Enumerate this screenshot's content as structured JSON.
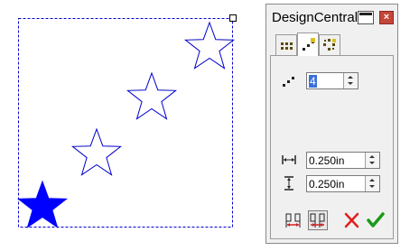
{
  "canvas": {
    "selection": "dashed-bounding-box",
    "stars": [
      {
        "name": "star-solid",
        "fill": "#0000ff"
      },
      {
        "name": "star-outline-2",
        "fill": "none"
      },
      {
        "name": "star-outline-3",
        "fill": "none"
      },
      {
        "name": "star-outline-4",
        "fill": "none"
      }
    ],
    "accent_color": "#0000cc"
  },
  "panel": {
    "title": "DesignCentral",
    "tabs": [
      {
        "icon": "grid-dots-icon",
        "active": false
      },
      {
        "icon": "diagonal-dots-icon",
        "active": true
      },
      {
        "icon": "circular-dots-icon",
        "active": false
      }
    ],
    "count": {
      "icon": "diagonal-dots-icon",
      "value": "4"
    },
    "horizontal_spacing": {
      "icon": "horizontal-spacing-icon",
      "value": "0.250in"
    },
    "vertical_spacing": {
      "icon": "vertical-spacing-icon",
      "value": "0.250in"
    },
    "buttons": [
      {
        "icon": "align-left-right-icon"
      },
      {
        "icon": "align-spread-icon",
        "pressed": true
      },
      {
        "icon": "cancel-x-icon",
        "color": "#e02020"
      },
      {
        "icon": "apply-check-icon",
        "color": "#1a9a1a"
      }
    ]
  }
}
